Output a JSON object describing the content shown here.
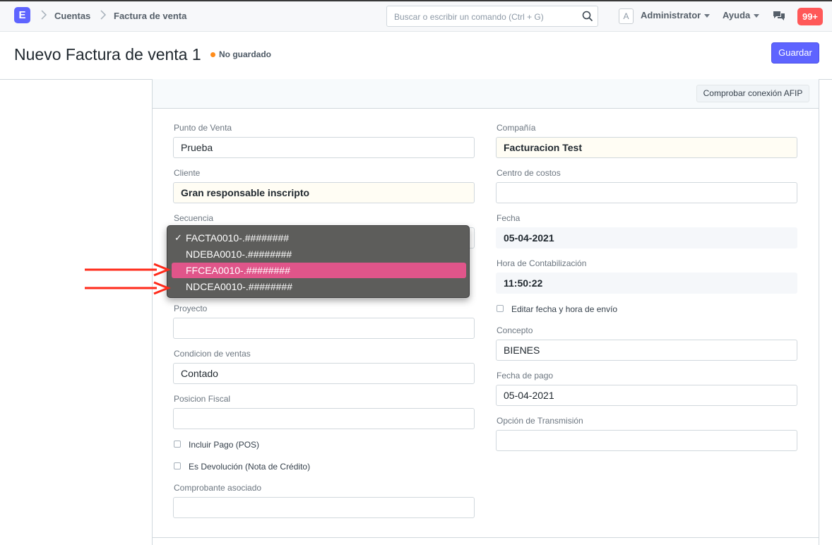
{
  "topbar": {
    "logo_letter": "E",
    "breadcrumbs": [
      "Cuentas",
      "Factura de venta"
    ],
    "search_placeholder": "Buscar o escribir un comando (Ctrl + G)",
    "avatar_letter": "A",
    "user_menu": "Administrator",
    "help_menu": "Ayuda",
    "notifications": "99+"
  },
  "header": {
    "title": "Nuevo Factura de venta 1",
    "status": "No guardado",
    "save_label": "Guardar"
  },
  "toolbar": {
    "afip_button": "Comprobar conexión AFIP"
  },
  "left": {
    "punto_venta": {
      "label": "Punto de Venta",
      "value": "Prueba"
    },
    "cliente": {
      "label": "Cliente",
      "value": "Gran responsable inscripto"
    },
    "secuencia": {
      "label": "Secuencia"
    },
    "proyecto": {
      "label": "Proyecto",
      "value": ""
    },
    "condicion": {
      "label": "Condicion de ventas",
      "value": "Contado"
    },
    "posicion": {
      "label": "Posicion Fiscal",
      "value": ""
    },
    "incluir_pago": "Incluir Pago (POS)",
    "es_devolucion": "Es Devolución (Nota de Crédito)",
    "comprobante": {
      "label": "Comprobante asociado",
      "value": ""
    }
  },
  "right": {
    "compania": {
      "label": "Compañía",
      "value": "Facturacion Test"
    },
    "centro_costos": {
      "label": "Centro de costos",
      "value": ""
    },
    "fecha": {
      "label": "Fecha",
      "value": "05-04-2021"
    },
    "hora": {
      "label": "Hora de Contabilización",
      "value": "11:50:22"
    },
    "editar_fecha": "Editar fecha y hora de envío",
    "concepto": {
      "label": "Concepto",
      "value": "BIENES"
    },
    "fecha_pago": {
      "label": "Fecha de pago",
      "value": "05-04-2021"
    },
    "opcion_transmision": {
      "label": "Opción de Transmisión",
      "value": ""
    }
  },
  "dropdown": {
    "checked_mark": "✓",
    "options": [
      "FACTA0010-.########",
      "NDEBA0010-.########",
      "FFCEA0010-.########",
      "NDCEA0010-.########"
    ],
    "checked_option": "FACTA0010-.########",
    "highlighted_option": "FFCEA0010-.########"
  },
  "colors": {
    "primary": "#5e64ff",
    "notification": "#ff5858",
    "status_dot": "#ff8c1a",
    "dropdown_highlight": "#e0558a",
    "annotation_arrow": "#ff2a1a"
  }
}
